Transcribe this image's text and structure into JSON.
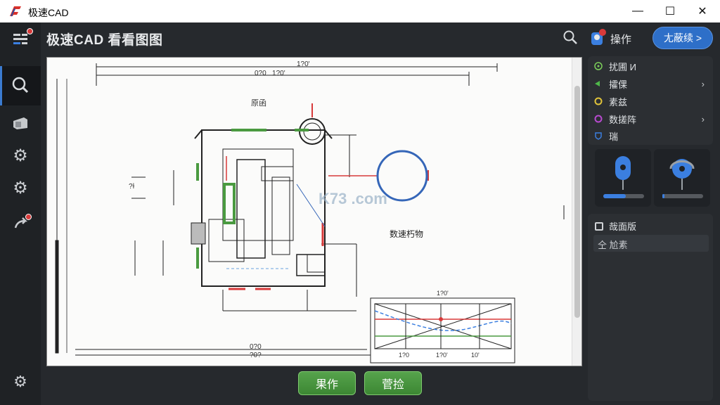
{
  "window": {
    "title": "极速CAD",
    "minimize": "—",
    "maximize": "☐",
    "close": "✕"
  },
  "header": {
    "title": "极速CAD  看看图图",
    "op_label": "操作",
    "blue_button": "尢蔽续 >"
  },
  "buttons": {
    "primary": "果作",
    "secondary": "菅捡"
  },
  "right_menu": [
    {
      "label": "扰圃 И",
      "icon_color": "#7ccf5a",
      "chevron": ""
    },
    {
      "label": "攉倮",
      "icon_color": "#4fb84a",
      "chevron": "›"
    },
    {
      "label": "素兹",
      "icon_color": "#e0c33a",
      "chevron": ""
    },
    {
      "label": "数搓阵",
      "icon_color": "#b84ad0",
      "chevron": "›"
    },
    {
      "label": "瑞",
      "icon_color": "#3b7fe0",
      "chevron": ""
    }
  ],
  "cards": [
    {
      "progress": 0.55
    },
    {
      "progress": 0.05
    }
  ],
  "bottom_panel": {
    "title": "哉面版",
    "input_value": "仝 尬素"
  },
  "drawing": {
    "top_dim_outer": "1?0'",
    "top_dim_inner": "0?0   1?0'",
    "bottom_dim_outer": "0?0",
    "bottom_dim_inner": "?0?",
    "label_top": "原函",
    "label_center": "数速朽物",
    "label_left": "?Ɨ",
    "chart_title": "1?0'",
    "chart_ticks": [
      "1?0",
      "1?0'",
      "10'"
    ],
    "watermark": "K73 .com"
  },
  "colors": {
    "accent": "#2e6fc8",
    "green": "#4a9a40",
    "red": "#d83a3a",
    "blue_circle": "#3566b8"
  }
}
